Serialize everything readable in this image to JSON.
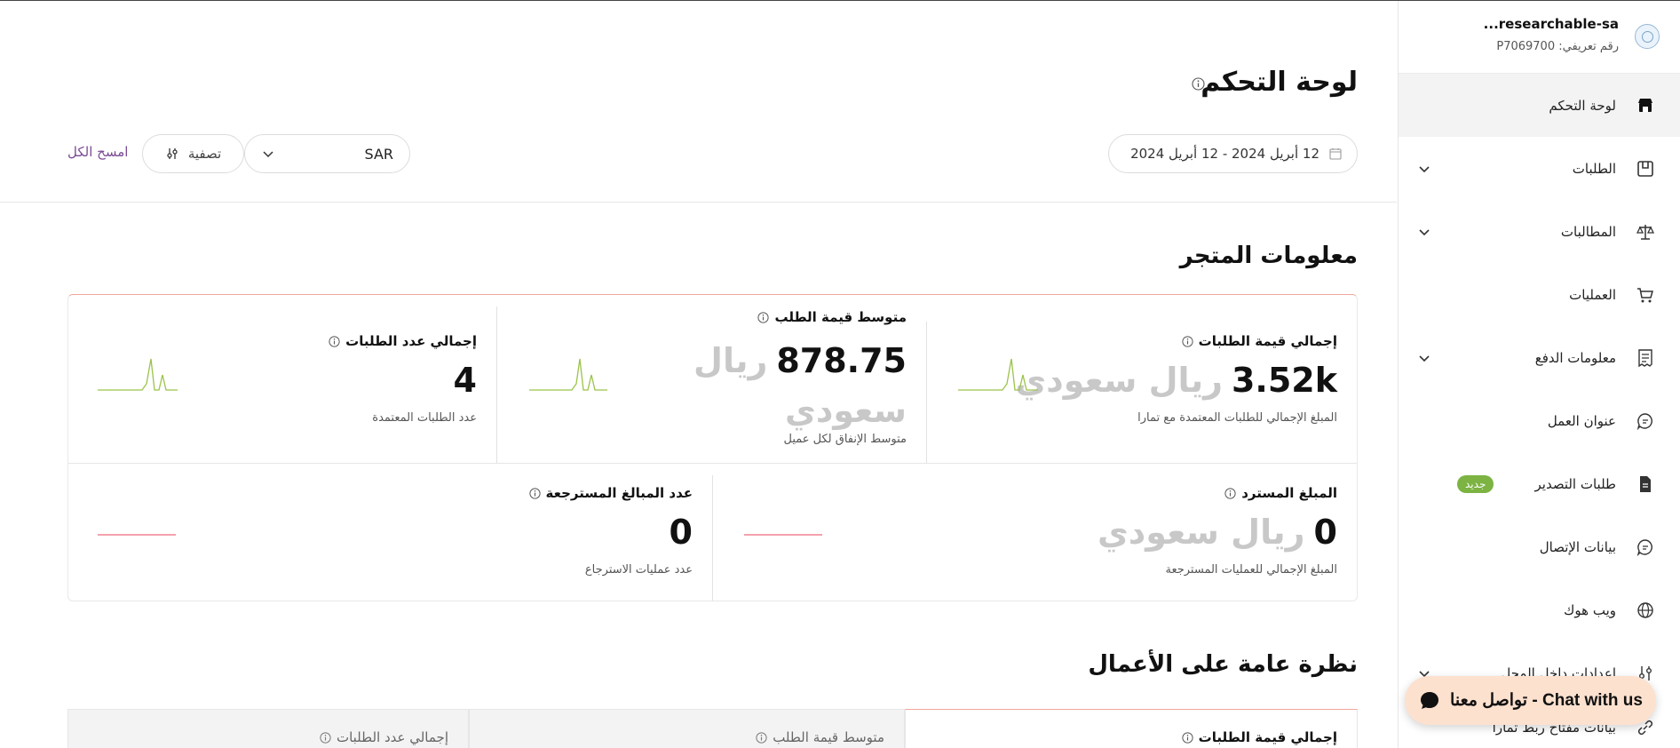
{
  "account": {
    "name": "researchable-sa...",
    "id": "رقم تعريفي: P7069700"
  },
  "sidebar": {
    "items": [
      {
        "label": "لوحة التحكم",
        "icon": "store-icon"
      },
      {
        "label": "الطلبات",
        "icon": "orders-icon"
      },
      {
        "label": "المطالبات",
        "icon": "scale-icon"
      },
      {
        "label": "العمليات",
        "icon": "cart-icon"
      },
      {
        "label": "معلومات الدفع",
        "icon": "receipt-icon"
      },
      {
        "label": "عنوان العمل",
        "icon": "chat-bubble-icon"
      },
      {
        "label": "طلبات التصدير",
        "icon": "document-icon",
        "badge": "جديد"
      },
      {
        "label": "بيانات الإتصال",
        "icon": "chat-bubble-icon"
      },
      {
        "label": "ويب هوك",
        "icon": "globe-icon"
      },
      {
        "label": "إعدادات داخل المحل",
        "icon": "sliders-icon"
      },
      {
        "label": "بيانات مفتاح ربط تمارا",
        "icon": "link-icon"
      }
    ]
  },
  "header": {
    "title": "لوحة التحكم",
    "date_range": "12 أبريل 2024  -  12 أبريل 2024",
    "currency": "SAR",
    "filter_label": "تصفية",
    "clear_label": "امسح الكل"
  },
  "store_info": {
    "title": "معلومات المتجر",
    "stats": [
      {
        "label": "إجمالي قيمة الطلبات",
        "value": "3.52k",
        "currency": "ريال سعودي",
        "sub": "المبلغ الإجمالي للطلبات المعتمدة مع تمارا"
      },
      {
        "label": "متوسط قيمة الطلب",
        "value": "878.75",
        "currency": "ريال سعودي",
        "sub": "متوسط الإنفاق لكل عميل"
      },
      {
        "label": "إجمالي عدد الطلبات",
        "value": "4",
        "sub": "عدد الطلبات المعتمدة"
      },
      {
        "label": "المبلغ المسترد",
        "value": "0",
        "currency": "ريال سعودي",
        "sub": "المبلغ الإجمالي للعمليات المسترجعة"
      },
      {
        "label": "عدد المبالغ المسترجعة",
        "value": "0",
        "sub": "عدد عمليات الاسترجاع"
      }
    ]
  },
  "overview": {
    "title": "نظرة عامة على الأعمال",
    "tabs": [
      {
        "label": "إجمالي قيمة الطلبات"
      },
      {
        "label": "متوسط قيمة الطلب"
      },
      {
        "label": "إجمالي عدد الطلبات"
      }
    ]
  },
  "chat": {
    "label": "تواصل معنا - Chat with us"
  },
  "colors": {
    "accent": "#7b4b94",
    "badge": "#7cb342",
    "spark_up": "#9bc34a",
    "spark_flat": "#ec6b7b",
    "card_top": "#f1a79b",
    "chat_bg": "#fde1cf"
  }
}
